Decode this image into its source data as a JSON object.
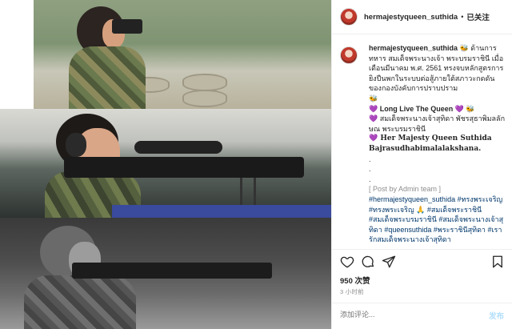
{
  "header": {
    "username": "hermajestyqueen_suthida",
    "separator": "•",
    "follow_label": "已关注"
  },
  "caption": {
    "username": "hermajestyqueen_suthida",
    "line1": "🐝 ด้านการทหาร สมเด็จพระนางเจ้า พระบรมราชินี เมื่อเดือนมีนาคม พ.ศ. 2561 ทรงจบหลักสูตรการยิงปืนพกในระบบต่อสู้ภายใต้สภาวะกดดันของกองบังคับการปราบปราม",
    "bee1": "🐝",
    "long_live": "💜 Long Live The Queen 💜 🐝",
    "thai_name": "💜 สมเด็จพระนางเจ้าสุทิดา พัชรสุธาพิมลลักษณ พระบรมราชินี",
    "english_name": "💜 Her Majesty Queen Suthida Bajrasudhabimalalakshana.",
    "dots": [
      ".",
      ".",
      "."
    ],
    "post_by": "[ Post by Admin team ]",
    "tags": "#hermajestyqueen_suthida #ทรงพระเจริญ #ทรงพระเจริญ 🙏 #สมเด็จพระราชินี #สมเด็จพระบรมราชินี #สมเด็จพระนางเจ้าสุทิดา #queensuthida #พระราชินีสุทิดา #เรารักสมเด็จพระนางเจ้าสุทิดา"
  },
  "actions": {
    "icons": [
      "heart-icon",
      "comment-icon",
      "share-icon",
      "bookmark-icon"
    ]
  },
  "likes": "950 次赞",
  "time_ago": "3 小时前",
  "comment": {
    "placeholder": "添加评论...",
    "post_label": "发布"
  },
  "colors": {
    "link": "#00376b",
    "muted": "#8e8e8e",
    "post_disabled": "#b2dffc",
    "border": "#efefef"
  }
}
